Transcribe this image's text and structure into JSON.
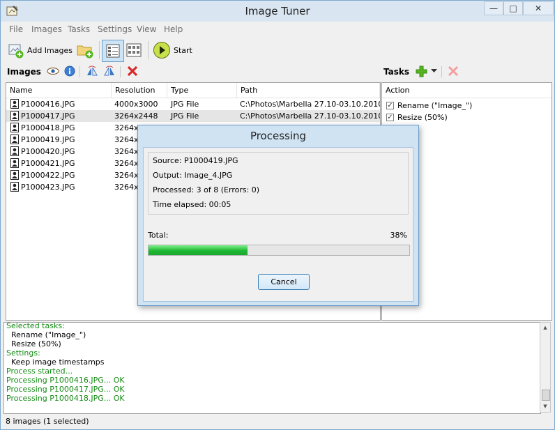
{
  "window": {
    "title": "Image Tuner",
    "min_glyph": "—",
    "max_glyph": "□",
    "close_glyph": "✕"
  },
  "menu": [
    "File",
    "Images",
    "Tasks",
    "Settings",
    "View",
    "Help"
  ],
  "toolbar": {
    "add_images_label": "Add Images",
    "start_label": "Start"
  },
  "images_panel": {
    "title": "Images",
    "columns": [
      "Name",
      "Resolution",
      "Type",
      "Path"
    ],
    "rows": [
      {
        "name": "P1000416.JPG",
        "resolution": "4000x3000",
        "type": "JPG File",
        "path": "C:\\Photos\\Marbella 27.10-03.10.2010\\"
      },
      {
        "name": "P1000417.JPG",
        "resolution": "3264x2448",
        "type": "JPG File",
        "path": "C:\\Photos\\Marbella 27.10-03.10.2010\\"
      },
      {
        "name": "P1000418.JPG",
        "resolution": "3264x2",
        "type": "",
        "path": ""
      },
      {
        "name": "P1000419.JPG",
        "resolution": "3264x2",
        "type": "",
        "path": ""
      },
      {
        "name": "P1000420.JPG",
        "resolution": "3264x2",
        "type": "",
        "path": ""
      },
      {
        "name": "P1000421.JPG",
        "resolution": "3264x2",
        "type": "",
        "path": ""
      },
      {
        "name": "P1000422.JPG",
        "resolution": "3264x2",
        "type": "",
        "path": ""
      },
      {
        "name": "P1000423.JPG",
        "resolution": "3264x2",
        "type": "",
        "path": ""
      }
    ]
  },
  "tasks_panel": {
    "title": "Tasks",
    "column": "Action",
    "tasks": [
      {
        "label": "Rename (\"Image_\")",
        "checked": "✓"
      },
      {
        "label": "Resize (50%)",
        "checked": "✓"
      }
    ]
  },
  "log": [
    {
      "text": "Selected tasks:",
      "color": "green"
    },
    {
      "text": "Rename (\"Image_\")",
      "color": "black"
    },
    {
      "text": "Resize (50%)",
      "color": "black"
    },
    {
      "text": "Settings:",
      "color": "green"
    },
    {
      "text": "Keep image timestamps",
      "color": "black"
    },
    {
      "text": "Process started...",
      "color": "green"
    },
    {
      "text": "Processing P1000416.JPG... OK",
      "color": "green"
    },
    {
      "text": "Processing P1000417.JPG... OK",
      "color": "green"
    },
    {
      "text": "Processing P1000418.JPG... OK",
      "color": "green"
    }
  ],
  "status": "8 images (1 selected)",
  "dialog": {
    "title": "Processing",
    "source": "Source: P1000419.JPG",
    "output": "Output: Image_4.JPG",
    "processed": "Processed: 3 of 8 (Errors: 0)",
    "elapsed": "Time elapsed: 00:05",
    "total_label": "Total:",
    "percent_label": "38%",
    "progress": 0.38,
    "cancel_label": "Cancel"
  },
  "colors": {
    "progress_green": "#1fb735",
    "log_green": "#138a13",
    "remove_red": "#d82a2a",
    "add_green": "#55b520"
  }
}
